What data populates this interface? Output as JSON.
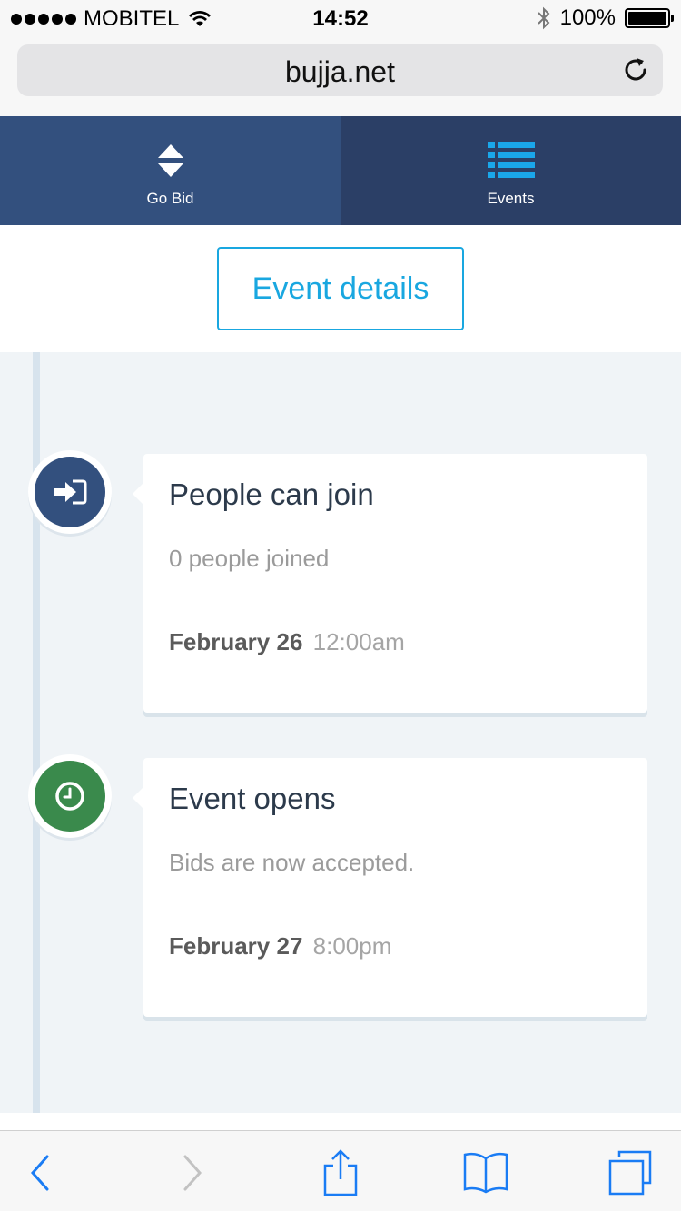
{
  "status_bar": {
    "carrier": "MOBITEL",
    "time": "14:52",
    "battery": "100%",
    "battery_level": 1.0,
    "signal_bars": 5
  },
  "browser": {
    "url": "bujja.net",
    "icons": [
      "reload-icon",
      "back-icon",
      "forward-icon",
      "share-icon",
      "bookmarks-icon",
      "tabs-icon"
    ]
  },
  "nav": {
    "tabs": [
      {
        "label": "Go Bid",
        "icon": "sort-arrows-icon"
      },
      {
        "label": "Events",
        "icon": "list-icon"
      }
    ]
  },
  "details_button": {
    "label": "Event details"
  },
  "timeline": {
    "events": [
      {
        "title": "People can join",
        "subtitle": "0 people joined",
        "date_day": "February 26",
        "date_time": "12:00am",
        "icon": "sign-in-icon",
        "color": "#33507e"
      },
      {
        "title": "Event opens",
        "subtitle": "Bids are now accepted.",
        "date_day": "February 27",
        "date_time": "8:00pm",
        "icon": "clock-icon",
        "color": "#3a8a4c"
      }
    ]
  },
  "colors": {
    "accent": "#19a7e0",
    "nav_left": "#33507e",
    "nav_right": "#2b3f66",
    "timeline_bg": "#f0f4f7",
    "ios_blue": "#1a7cf4"
  }
}
